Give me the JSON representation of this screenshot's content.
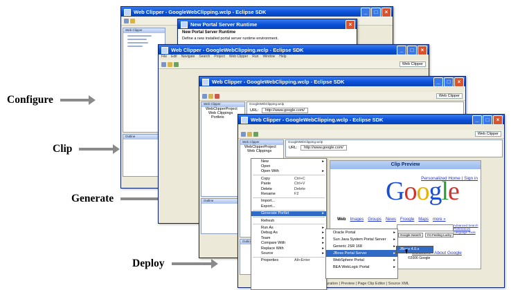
{
  "stages": [
    "Configure",
    "Clip",
    "Generate",
    "Deploy"
  ],
  "window_back": {
    "title": "Web Clipper - GoogleWebClipping.wclp - Eclipse SDK",
    "pane_tab": "Web Clipper",
    "type_filter": "type filter text",
    "tree_items": [
      "General",
      "Ant"
    ],
    "outline_tab": "Outline"
  },
  "dialog": {
    "title": "New Portal Server Runtime",
    "heading": "New Portal Server Runtime",
    "description": "Define a new installed portal server runtime environment."
  },
  "window_2": {
    "title": "Web Clipper - GoogleWebClipping.wclp - Eclipse SDK",
    "menu": [
      "File",
      "Edit",
      "Navigate",
      "Search",
      "Project",
      "Web Clipper",
      "Run",
      "Window",
      "Help"
    ],
    "perspective": "Web Clipper"
  },
  "window_3": {
    "title": "Web Clipper - GoogleWebClipping.wclp - Eclipse SDK",
    "perspective": "Web Clipper",
    "pane_tab": "Web Clipper",
    "editor_tab": "GoogleWebClipping.wclp",
    "url_label": "URL:",
    "url": "http://www.google.com/",
    "outline_tab": "Outline",
    "tree_items": [
      "WebClipperProject",
      "Web Clippings",
      "Portlets"
    ]
  },
  "window_4": {
    "title": "Web Clipper - GoogleWebClipping.wclp - Eclipse SDK",
    "perspective": "Web Clipper",
    "pane_tab": "Web Clipper",
    "editor_tab": "GoogleWebClipping.wclp",
    "url_label": "URL:",
    "url": "http://www.google.com/",
    "outline_tab": "Outline",
    "tree_items": [
      "WebClipperProject",
      "Web Clippings"
    ],
    "bottom_tabs": "Design | Browser Configuration | Preview | Page Clip Editor | Source XML"
  },
  "clip_preview": {
    "title": "Clip Preview",
    "top_links": "Personalized Home | Sign in",
    "logo": "Google",
    "nav": [
      "Web",
      "Images",
      "Groups",
      "News",
      "Froogle",
      "Maps",
      "more »"
    ],
    "side_links": [
      "Advanced Search",
      "Preferences",
      "Language Tools"
    ],
    "footer_links": "Solutions - About Google",
    "copyright": "©2006 Google",
    "search_button": "Google Search",
    "lucky_button": "I'm Feeling Lucky"
  },
  "context_menu": {
    "items": [
      {
        "label": "New",
        "sub": true
      },
      {
        "label": "Open"
      },
      {
        "label": "Open With",
        "sub": true
      },
      {
        "sep": true
      },
      {
        "label": "Copy",
        "shortcut": "Ctrl+C"
      },
      {
        "label": "Paste",
        "shortcut": "Ctrl+V"
      },
      {
        "label": "Delete",
        "shortcut": "Delete"
      },
      {
        "label": "Rename",
        "shortcut": "F2"
      },
      {
        "sep": true
      },
      {
        "label": "Import..."
      },
      {
        "label": "Export..."
      },
      {
        "sep": true
      },
      {
        "label": "Generate Portlet",
        "sub": true,
        "highlight": true
      },
      {
        "sep": true
      },
      {
        "label": "Refresh"
      },
      {
        "sep": true
      },
      {
        "label": "Run As",
        "sub": true
      },
      {
        "label": "Debug As",
        "sub": true
      },
      {
        "label": "Team",
        "sub": true
      },
      {
        "label": "Compare With",
        "sub": true
      },
      {
        "label": "Replace With",
        "sub": true
      },
      {
        "label": "Source",
        "sub": true
      },
      {
        "sep": true
      },
      {
        "label": "Properties",
        "shortcut": "Alt+Enter"
      }
    ]
  },
  "submenu": {
    "items": [
      {
        "label": "Oracle Portal",
        "sub": true
      },
      {
        "label": "Sun Java System Portal Server",
        "sub": true
      },
      {
        "label": "Generic JSR 168",
        "sub": true
      },
      {
        "label": "JBoss Portal Server",
        "sub": true,
        "highlight": true
      },
      {
        "label": "WebSphere Portal",
        "sub": true
      },
      {
        "label": "BEA WebLogic Portal",
        "sub": true
      }
    ]
  },
  "deploy_option": "JBoss 4.0.x"
}
